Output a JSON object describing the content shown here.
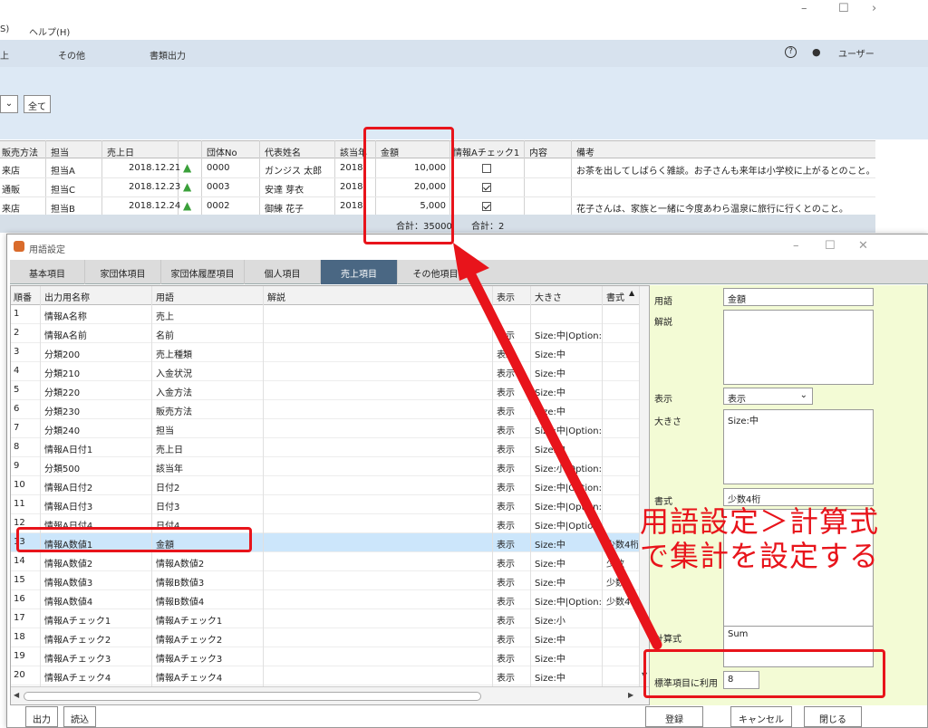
{
  "bg_window": {
    "title_controls": {
      "minimize": "–",
      "maximize": "☐",
      "close": "›"
    },
    "menu": {
      "m1": "S)",
      "help": "ヘルプ(H)"
    },
    "toolbar": {
      "t1": "上",
      "other": "その他",
      "docs": "書類出力",
      "help_icon": "?",
      "user": "ユーザー"
    },
    "filter": {
      "all_button": "全て"
    },
    "grid": {
      "headers": [
        "販売方法",
        "担当",
        "売上日",
        "",
        "団体No",
        "代表姓名",
        "該当年",
        "金額",
        "情報Aチェック1",
        "内容",
        "備考"
      ],
      "rows": [
        {
          "method": "来店",
          "staff": "担当A",
          "date": "2018.12.21",
          "group": "0000",
          "name": "ガンジス 太郎",
          "year": "2018",
          "amount": "10,000",
          "check": false,
          "content": "",
          "note": "お茶を出してしばらく雑談。お子さんも来年は小学校に上がるとのこと。"
        },
        {
          "method": "通販",
          "staff": "担当C",
          "date": "2018.12.23",
          "group": "0003",
          "name": "安達 芽衣",
          "year": "2018",
          "amount": "20,000",
          "check": true,
          "content": "",
          "note": ""
        },
        {
          "method": "来店",
          "staff": "担当B",
          "date": "2018.12.24",
          "group": "0002",
          "name": "御練 花子",
          "year": "2018",
          "amount": "5,000",
          "check": true,
          "content": "",
          "note": "花子さんは、家族と一緒に今度あわら温泉に旅行に行くとのこと。"
        }
      ],
      "sum_amount": "合計：35000",
      "sum_check": "合計：2"
    }
  },
  "dialog": {
    "title": "用語設定",
    "controls": {
      "minimize": "–",
      "maximize": "☐",
      "close": "✕"
    },
    "tabs": [
      "基本項目",
      "家団体項目",
      "家団体履歴項目",
      "個人項目",
      "売上項目",
      "その他項目"
    ],
    "active_tab": "売上項目",
    "list_headers": [
      "順番",
      "出力用名称",
      "用語",
      "解説",
      "表示",
      "大きさ",
      "書式"
    ],
    "rows": [
      {
        "n": "1",
        "out": "情報A名称",
        "term": "売上",
        "desc": "",
        "show": "",
        "size": "",
        "fmt": ""
      },
      {
        "n": "2",
        "out": "情報A名前",
        "term": "名前",
        "desc": "",
        "show": "表示",
        "size": "Size:中|Option:i",
        "fmt": ""
      },
      {
        "n": "3",
        "out": "分類200",
        "term": "売上種類",
        "desc": "",
        "show": "表示",
        "size": "Size:中",
        "fmt": ""
      },
      {
        "n": "4",
        "out": "分類210",
        "term": "入金状況",
        "desc": "",
        "show": "表示",
        "size": "Size:中",
        "fmt": ""
      },
      {
        "n": "5",
        "out": "分類220",
        "term": "入金方法",
        "desc": "",
        "show": "表示",
        "size": "Size:中",
        "fmt": ""
      },
      {
        "n": "6",
        "out": "分類230",
        "term": "販売方法",
        "desc": "",
        "show": "表示",
        "size": "Size:中",
        "fmt": ""
      },
      {
        "n": "7",
        "out": "分類240",
        "term": "担当",
        "desc": "",
        "show": "表示",
        "size": "Size:中|Option:i",
        "fmt": ""
      },
      {
        "n": "8",
        "out": "情報A日付1",
        "term": "売上日",
        "desc": "",
        "show": "表示",
        "size": "Size:中",
        "fmt": ""
      },
      {
        "n": "9",
        "out": "分類500",
        "term": "該当年",
        "desc": "",
        "show": "表示",
        "size": "Size:小|Option:",
        "fmt": ""
      },
      {
        "n": "10",
        "out": "情報A日付2",
        "term": "日付2",
        "desc": "",
        "show": "表示",
        "size": "Size:中|Option:",
        "fmt": ""
      },
      {
        "n": "11",
        "out": "情報A日付3",
        "term": "日付3",
        "desc": "",
        "show": "表示",
        "size": "Size:中|Option:",
        "fmt": ""
      },
      {
        "n": "12",
        "out": "情報A日付4",
        "term": "日付4",
        "desc": "",
        "show": "表示",
        "size": "Size:中|Option:",
        "fmt": ""
      },
      {
        "n": "13",
        "out": "情報A数値1",
        "term": "金額",
        "desc": "",
        "show": "表示",
        "size": "Size:中",
        "fmt": "少数4桁"
      },
      {
        "n": "14",
        "out": "情報A数値2",
        "term": "情報A数値2",
        "desc": "",
        "show": "表示",
        "size": "Size:中",
        "fmt": "少数"
      },
      {
        "n": "15",
        "out": "情報A数値3",
        "term": "情報B数値3",
        "desc": "",
        "show": "表示",
        "size": "Size:中",
        "fmt": "少数"
      },
      {
        "n": "16",
        "out": "情報A数値4",
        "term": "情報B数値4",
        "desc": "",
        "show": "表示",
        "size": "Size:中|Option:",
        "fmt": "少数4"
      },
      {
        "n": "17",
        "out": "情報Aチェック1",
        "term": "情報Aチェック1",
        "desc": "",
        "show": "表示",
        "size": "Size:小",
        "fmt": ""
      },
      {
        "n": "18",
        "out": "情報Aチェック2",
        "term": "情報Aチェック2",
        "desc": "",
        "show": "表示",
        "size": "Size:中",
        "fmt": ""
      },
      {
        "n": "19",
        "out": "情報Aチェック3",
        "term": "情報Aチェック3",
        "desc": "",
        "show": "表示",
        "size": "Size:中",
        "fmt": ""
      },
      {
        "n": "20",
        "out": "情報Aチェック4",
        "term": "情報Aチェック4",
        "desc": "",
        "show": "表示",
        "size": "Size:中",
        "fmt": ""
      }
    ],
    "selected_row": "13",
    "detail": {
      "term_label": "用語",
      "term_value": "金額",
      "desc_label": "解説",
      "desc_value": "",
      "show_label": "表示",
      "show_value": "表示",
      "size_label": "大きさ",
      "size_value": "Size:中",
      "fmt_label": "書式",
      "fmt_value": "少数4桁",
      "formula_label": "計算式",
      "formula_value": "Sum",
      "std_label": "標準項目に利用",
      "std_value": "8"
    },
    "buttons": {
      "output": "出力",
      "import": "読込",
      "register": "登録",
      "cancel": "キャンセル",
      "close": "閉じる"
    }
  },
  "annotation": {
    "line1": "用語設定＞計算式",
    "line2": "で集計を設定する",
    "color": "#e8141b"
  }
}
